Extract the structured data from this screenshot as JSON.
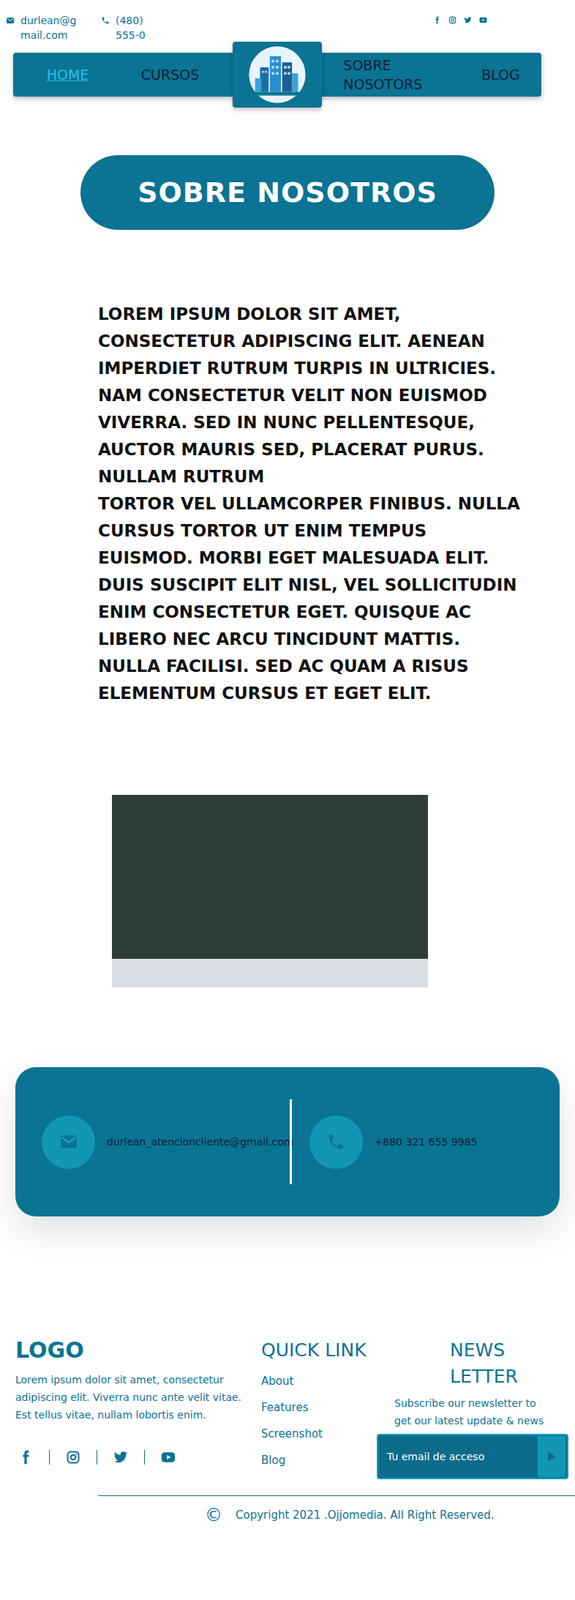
{
  "top_contact": {
    "email": "durlean@gmail.com",
    "phone": "(480) 555-0"
  },
  "nav": {
    "items": [
      {
        "label": "HOME",
        "selected": true
      },
      {
        "label": "CURSOS",
        "selected": false
      },
      {
        "label": "SOBRE NOSOTORS",
        "selected": false
      },
      {
        "label": "BLOG",
        "selected": false
      }
    ]
  },
  "hero": {
    "title": "SOBRE NOSOTROS"
  },
  "about": {
    "paragraphs": [
      "LOREM IPSUM DOLOR SIT AMET, CONSECTETUR ADIPISCING ELIT. AENEAN IMPERDIET RUTRUM TURPIS IN ULTRICIES. NAM CONSECTETUR VELIT NON EUISMOD VIVERRA. SED IN NUNC PELLENTESQUE, AUCTOR MAURIS SED, PLACERAT PURUS. NULLAM RUTRUM",
      "TORTOR VEL ULLAMCORPER FINIBUS. NULLA CURSUS TORTOR UT ENIM TEMPUS EUISMOD. MORBI EGET MALESUADA ELIT. DUIS SUSCIPIT ELIT NISL, VEL SOLLICITUDIN ENIM CONSECTETUR EGET. QUISQUE AC LIBERO NEC ARCU TINCIDUNT MATTIS. NULLA FACILISI. SED AC QUAM A RISUS ELEMENTUM CURSUS ET EGET ELIT."
    ]
  },
  "contact_card": {
    "email": "durlean_atencioncliente@gmail.com",
    "phone": "+880 321 655 9985"
  },
  "footer": {
    "logo": "LOGO",
    "description": "Lorem ipsum dolor sit amet, consectetur adipiscing elit. Viverra nunc ante velit vitae. Est tellus vitae, nullam lobortis enim.",
    "quick_link": {
      "title": "QUICK LINK",
      "links": [
        "About",
        "Features",
        "Screenshot",
        "Blog"
      ]
    },
    "newsletter": {
      "title": "NEWS LETTER",
      "description": "Subscribe our newsletter to get our latest update & news",
      "placeholder": "Tu email de acceso"
    },
    "copyright_icon": "©",
    "copyright": "Copyright 2021 .Ojjomedia. All Right Reserved."
  }
}
